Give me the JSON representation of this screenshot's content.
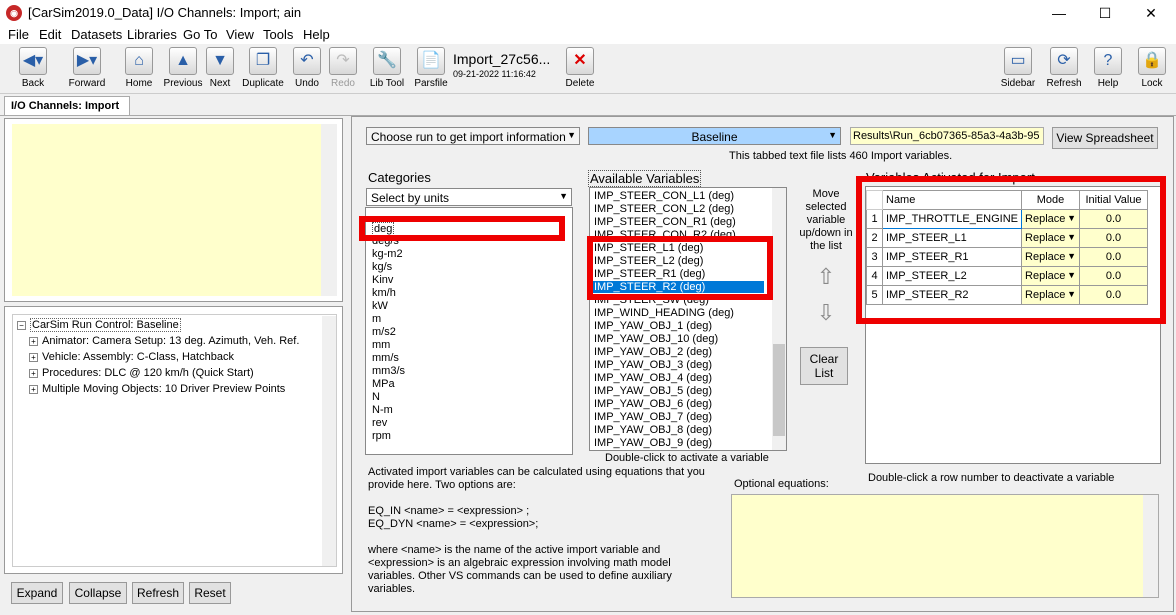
{
  "window": {
    "title": "[CarSim2019.0_Data] I/O Channels: Import; ain",
    "minimize": "—",
    "maximize": "☐",
    "close": "✕"
  },
  "menu": [
    "File",
    "Edit",
    "Datasets",
    "Libraries",
    "Go To",
    "View",
    "Tools",
    "Help"
  ],
  "toolbar": {
    "back": "Back",
    "forward": "Forward",
    "home": "Home",
    "previous": "Previous",
    "next": "Next",
    "duplicate": "Duplicate",
    "undo": "Undo",
    "redo": "Redo",
    "lib_tool": "Lib Tool",
    "parsfile": "Parsfile",
    "dataset_name": "Import_27c56...",
    "dataset_date": "09-21-2022 11:16:42",
    "delete": "Delete",
    "sidebar": "Sidebar",
    "refresh": "Refresh",
    "help": "Help",
    "lock": "Lock"
  },
  "tab": "I/O Channels: Import",
  "left": {
    "tree": [
      {
        "label": "CarSim Run Control: Baseline",
        "level": 0,
        "expander": "−"
      },
      {
        "label": "Animator: Camera Setup: 13 deg. Azimuth, Veh. Ref.",
        "level": 1,
        "expander": "+"
      },
      {
        "label": "Vehicle: Assembly: C-Class, Hatchback",
        "level": 1,
        "expander": "+"
      },
      {
        "label": "Procedures: DLC @ 120 km/h (Quick Start)",
        "level": 1,
        "expander": "+"
      },
      {
        "label": "Multiple Moving Objects: 10 Driver Preview Points",
        "level": 1,
        "expander": "+"
      }
    ],
    "buttons": {
      "expand": "Expand",
      "collapse": "Collapse",
      "refresh": "Refresh",
      "reset": "Reset"
    }
  },
  "main": {
    "run_dropdown": "Choose run to get import information",
    "baseline_dropdown": "Baseline",
    "results_path": "Results\\Run_6cb07365-85a3-4a3b-95",
    "view_spreadsheet": "View Spreadsheet",
    "file_info": "This tabbed text file lists 460 Import variables.",
    "categories_title": "Categories",
    "categories_dropdown": "Select by units",
    "categories": [
      "deg",
      "deg/s",
      "kg-m2",
      "kg/s",
      "Kinv",
      "km/h",
      "kW",
      "m",
      "m/s2",
      "mm",
      "mm/s",
      "mm3/s",
      "MPa",
      "N",
      "N-m",
      "rev",
      "rpm"
    ],
    "available_title": "Available Variables",
    "available": [
      "IMP_STEER_CON_L1 (deg)",
      "IMP_STEER_CON_L2 (deg)",
      "IMP_STEER_CON_R1 (deg)",
      "IMP_STEER_CON_R2 (deg)",
      "IMP_STEER_L1 (deg)",
      "IMP_STEER_L2 (deg)",
      "IMP_STEER_R1 (deg)",
      "IMP_STEER_R2 (deg)",
      "IMP_STEER_SW (deg)",
      "IMP_WIND_HEADING (deg)",
      "IMP_YAW_OBJ_1 (deg)",
      "IMP_YAW_OBJ_10 (deg)",
      "IMP_YAW_OBJ_2 (deg)",
      "IMP_YAW_OBJ_3 (deg)",
      "IMP_YAW_OBJ_4 (deg)",
      "IMP_YAW_OBJ_5 (deg)",
      "IMP_YAW_OBJ_6 (deg)",
      "IMP_YAW_OBJ_7 (deg)",
      "IMP_YAW_OBJ_8 (deg)",
      "IMP_YAW_OBJ_9 (deg)"
    ],
    "available_selected_index": 7,
    "double_click_activate": "Double-click to activate a variable",
    "move_hint": "Move selected variable up/down in the list",
    "clear_list": "Clear List",
    "activated_title": "Variables Activated for Import",
    "activated_headers": {
      "name": "Name",
      "mode": "Mode",
      "initial": "Initial Value"
    },
    "activated": [
      {
        "num": "1",
        "name": "IMP_THROTTLE_ENGINE",
        "mode": "Replace",
        "initial": "0.0"
      },
      {
        "num": "2",
        "name": "IMP_STEER_L1",
        "mode": "Replace",
        "initial": "0.0"
      },
      {
        "num": "3",
        "name": "IMP_STEER_R1",
        "mode": "Replace",
        "initial": "0.0"
      },
      {
        "num": "4",
        "name": "IMP_STEER_L2",
        "mode": "Replace",
        "initial": "0.0"
      },
      {
        "num": "5",
        "name": "IMP_STEER_R2",
        "mode": "Replace",
        "initial": "0.0"
      }
    ],
    "double_click_deactivate": "Double-click a row number to deactivate a variable",
    "info_text_1": "Activated import variables can be calculated using equations that you provide here. Two options are:",
    "eq_in": "EQ_IN <name> = <expression> ;",
    "eq_dyn": "EQ_DYN <name> = <expression>;",
    "info_text_2": "where <name> is the name of the active import variable and <expression> is an algebraic expression involving math model variables. Other VS commands can be used to define auxiliary variables.",
    "optional_equations": "Optional equations:"
  },
  "colors": {
    "highlight_red": "#e00000",
    "selection_blue": "#0078d7",
    "note_yellow": "#ffffcc",
    "baseline_blue": "#a8d4ff"
  }
}
